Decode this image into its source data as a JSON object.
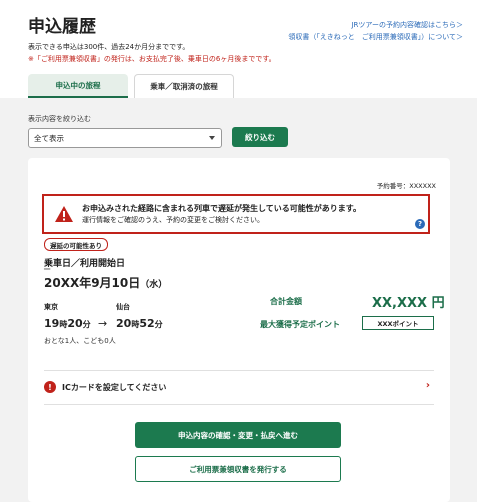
{
  "page": {
    "title": "申込履歴",
    "note1": "表示できる申込は300件、過去24か月分までです。",
    "note2": "※「ご利用票兼領収書」の発行は、お支払完了後、乗車日の6ヶ月後までです。",
    "link_tour": "JRツアーの予約内容確認はこちら＞",
    "link_receipt": "領収書（「えきねっと　ご利用票兼領収書」）について＞"
  },
  "tabs": [
    {
      "label": "申込中の旅程"
    },
    {
      "label": "乗車／取消済の旅程"
    }
  ],
  "filter": {
    "label": "表示内容を絞り込む",
    "selected": "全て表示",
    "button": "絞り込む"
  },
  "card": {
    "reserve_no": "予約番号：XXXXXX",
    "alert_title": "お申込みされた経路に含まれる列車で遅延が発生している可能性があります。",
    "alert_body": "運行情報をご確認のうえ、予約の変更をご検討ください。",
    "help": "?",
    "delay_badge": "遅延の可能性あり",
    "ride_label": "乗車日／利用開始日",
    "ride_sub": "━━",
    "ride_date": "20XX年9月10日",
    "ride_dow": "（水）",
    "from_station": "東京",
    "to_station": "仙台",
    "dep_hour": "19",
    "dep_min": "20",
    "arr_hour": "20",
    "arr_min": "52",
    "hour_unit": "時",
    "min_unit": "分",
    "arrow": "→",
    "passengers": "おとな1人、こども0人",
    "total_label": "合計金額",
    "total_value": "XX,XXX 円",
    "points_label": "最大獲得予定ポイント",
    "points_value": "XXXポイント",
    "ic_text": "ICカードを設定してください",
    "ic_mark": "!",
    "ic_chevron": "›",
    "btn_primary": "申込内容の確認・変更・払戻へ進む",
    "btn_secondary": "ご利用票兼領収書を発行する"
  },
  "colors": {
    "accent_green": "#1c7a4f",
    "alert_red": "#c0221a",
    "link_blue": "#2a6ab8"
  }
}
